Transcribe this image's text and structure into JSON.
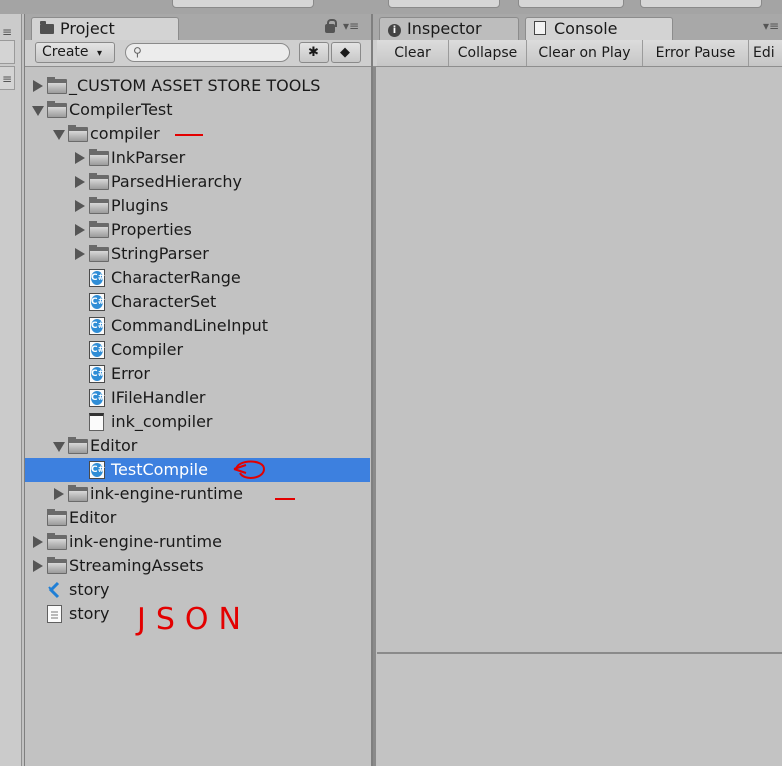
{
  "project_panel": {
    "tab_label": "Project",
    "create_label": "Create",
    "create_arrow": "▾",
    "search_placeholder": ""
  },
  "right_panel": {
    "tabs": [
      {
        "label": "Inspector",
        "icon": "info-icon"
      },
      {
        "label": "Console",
        "icon": "console-icon"
      }
    ],
    "console_buttons": [
      "Clear",
      "Collapse",
      "Clear on Play",
      "Error Pause",
      "Edi"
    ]
  },
  "tree": [
    {
      "label": "_CUSTOM ASSET STORE TOOLS",
      "type": "folder",
      "depth": 0,
      "expander": "collapsed"
    },
    {
      "label": "CompilerTest",
      "type": "folder",
      "depth": 0,
      "expander": "expanded"
    },
    {
      "label": "compiler",
      "type": "folder",
      "depth": 1,
      "expander": "expanded"
    },
    {
      "label": "InkParser",
      "type": "folder",
      "depth": 2,
      "expander": "collapsed"
    },
    {
      "label": "ParsedHierarchy",
      "type": "folder",
      "depth": 2,
      "expander": "collapsed"
    },
    {
      "label": "Plugins",
      "type": "folder",
      "depth": 2,
      "expander": "collapsed"
    },
    {
      "label": "Properties",
      "type": "folder",
      "depth": 2,
      "expander": "collapsed"
    },
    {
      "label": "StringParser",
      "type": "folder",
      "depth": 2,
      "expander": "collapsed"
    },
    {
      "label": "CharacterRange",
      "type": "script",
      "depth": 2,
      "expander": "none"
    },
    {
      "label": "CharacterSet",
      "type": "script",
      "depth": 2,
      "expander": "none"
    },
    {
      "label": "CommandLineInput",
      "type": "script",
      "depth": 2,
      "expander": "none"
    },
    {
      "label": "Compiler",
      "type": "script",
      "depth": 2,
      "expander": "none"
    },
    {
      "label": "Error",
      "type": "script",
      "depth": 2,
      "expander": "none"
    },
    {
      "label": "IFileHandler",
      "type": "script",
      "depth": 2,
      "expander": "none"
    },
    {
      "label": "ink_compiler",
      "type": "asset",
      "depth": 2,
      "expander": "none"
    },
    {
      "label": "Editor",
      "type": "folder",
      "depth": 1,
      "expander": "expanded"
    },
    {
      "label": "TestCompile",
      "type": "script",
      "depth": 2,
      "expander": "none",
      "selected": true
    },
    {
      "label": "ink-engine-runtime",
      "type": "folder",
      "depth": 1,
      "expander": "collapsed"
    },
    {
      "label": "Editor",
      "type": "folder",
      "depth": 0,
      "expander": "none"
    },
    {
      "label": "ink-engine-runtime",
      "type": "folder",
      "depth": 0,
      "expander": "collapsed"
    },
    {
      "label": "StreamingAssets",
      "type": "folder",
      "depth": 0,
      "expander": "collapsed"
    },
    {
      "label": "story",
      "type": "vscode",
      "depth": 0,
      "expander": "none"
    },
    {
      "label": "story",
      "type": "text",
      "depth": 0,
      "expander": "none"
    }
  ],
  "annotation_json": "JSON",
  "colors": {
    "selection": "#3d80df",
    "annotation": "#e30000",
    "csharp_icon": "#2f8dd6"
  }
}
